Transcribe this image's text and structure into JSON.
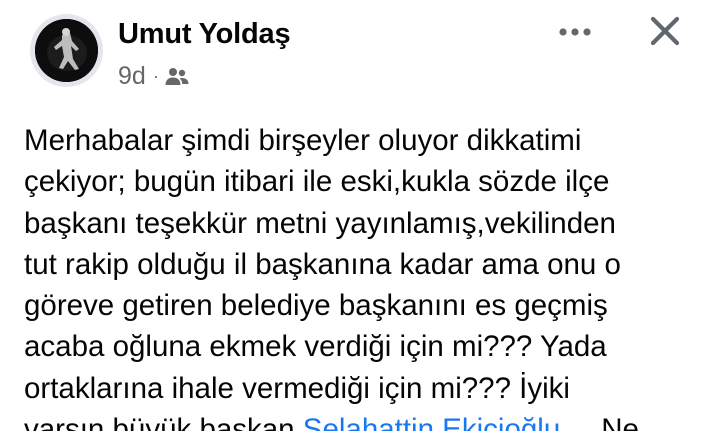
{
  "post": {
    "author_name": "Umut Yoldaş",
    "timestamp": "9d",
    "separator": "·",
    "audience_icon": "friends-icon",
    "header_actions": {
      "more_icon": "more-horizontal-icon",
      "close_icon": "close-icon"
    },
    "body_lines": [
      "Merhabalar şimdi birşeyler oluyor dikkatimi",
      "çekiyor; bugün itibari ile eski,kukla sözde ilçe",
      "başkanı teşekkür metni yayınlamış,vekilinden",
      "tut rakip olduğu il başkanına kadar ama onu o",
      "göreve getiren belediye başkanını es geçmiş",
      "acaba oğluna ekmek verdiği için mi??? Yada",
      "ortaklarına ihale vermediği için mi??? İyiki"
    ],
    "last_line": {
      "prefix": "varsın büyük başkan ",
      "mention": "Selahattin Ekicioğlu",
      "see_more": " ... Ne"
    }
  },
  "colors": {
    "text": "#050505",
    "secondary_text": "#65676b",
    "link": "#1877f2",
    "background": "#ffffff"
  }
}
